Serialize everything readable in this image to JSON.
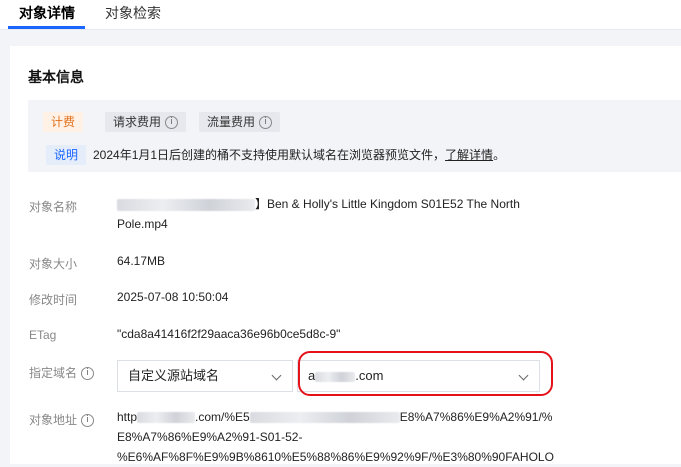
{
  "tabs": {
    "detail": "对象详情",
    "search": "对象检索"
  },
  "section": {
    "title": "基本信息"
  },
  "info_box": {
    "billing_tag": "计费",
    "request_fee": "请求费用",
    "traffic_fee": "流量费用",
    "note_tag": "说明",
    "note_text": "2024年1月1日后创建的桶不支持使用默认域名在浏览器预览文件，",
    "note_link": "了解详情",
    "note_end": "。"
  },
  "fields": {
    "name_label": "对象名称",
    "name_value_line1": "】Ben & Holly's Little Kingdom S01E52 The North",
    "name_value_line2": "Pole.mp4",
    "size_label": "对象大小",
    "size_value": "64.17MB",
    "mtime_label": "修改时间",
    "mtime_value": "2025-07-08 10:50:04",
    "etag_label": "ETag",
    "etag_value": "\"cda8a41416f2f29aaca36e96b0ce5d8c-9\"",
    "domain_label": "指定域名",
    "domain_type_selected": "自定义源站域名",
    "domain_selected_suffix": ".com",
    "url_label": "对象地址",
    "url_part1": "http",
    "url_part2": ".com/%E5",
    "url_part3": "E8%A7%86%E9%A2%91/%",
    "url_line2": "E8%A7%86%E9%A2%91-S01-52-",
    "url_line3": "%E6%AF%8F%E9%9B%8610%E5%88%86%E9%92%9F/%E3%80%90FAHOLO"
  },
  "colors": {
    "accent": "#1b66ff",
    "highlight": "#e4111a",
    "billing": "#e2701c"
  }
}
